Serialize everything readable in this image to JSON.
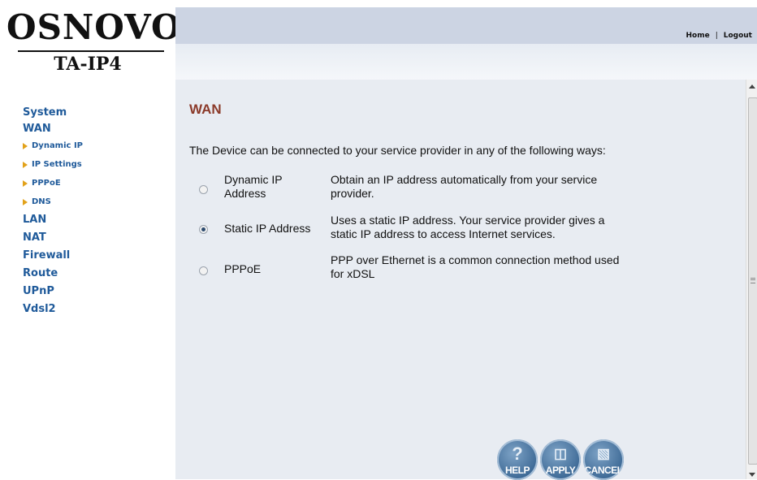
{
  "logo": {
    "brand": "OSNOVO",
    "model": "TA-IP4"
  },
  "header": {
    "links": {
      "home": "Home",
      "separator": "|",
      "logout": "Logout"
    }
  },
  "sidebar": {
    "items": [
      {
        "label": "System",
        "level": "main"
      },
      {
        "label": "WAN",
        "level": "main"
      },
      {
        "label": "Dynamic IP",
        "level": "sub"
      },
      {
        "label": "IP Settings",
        "level": "sub"
      },
      {
        "label": "PPPoE",
        "level": "sub"
      },
      {
        "label": "DNS",
        "level": "sub"
      },
      {
        "label": "LAN",
        "level": "main"
      },
      {
        "label": "NAT",
        "level": "main"
      },
      {
        "label": "Firewall",
        "level": "main"
      },
      {
        "label": "Route",
        "level": "main"
      },
      {
        "label": "UPnP",
        "level": "main"
      },
      {
        "label": "Vdsl2",
        "level": "main"
      }
    ]
  },
  "main": {
    "title": "WAN",
    "intro": "The Device can be connected to your service provider in any of the following ways:",
    "options": [
      {
        "label": "Dynamic IP Address",
        "description": "Obtain an IP address automatically from your service provider.",
        "selected": false
      },
      {
        "label": "Static IP Address",
        "description": "Uses a static IP address. Your service provider gives a static IP address to access Internet services.",
        "selected": true
      },
      {
        "label": "PPPoE",
        "description": "PPP over Ethernet is a common connection method used for xDSL",
        "selected": false
      }
    ]
  },
  "buttons": {
    "help": "HELP",
    "apply": "APPLY",
    "cancel": "CANCEL"
  },
  "colors": {
    "accent": "#1f5a9a",
    "title": "#8b3a2a",
    "header_bar": "#ccd4e3",
    "content_bg": "#e8ecf2",
    "nav_arrow": "#e2a21a",
    "button": "#4c78a4"
  }
}
